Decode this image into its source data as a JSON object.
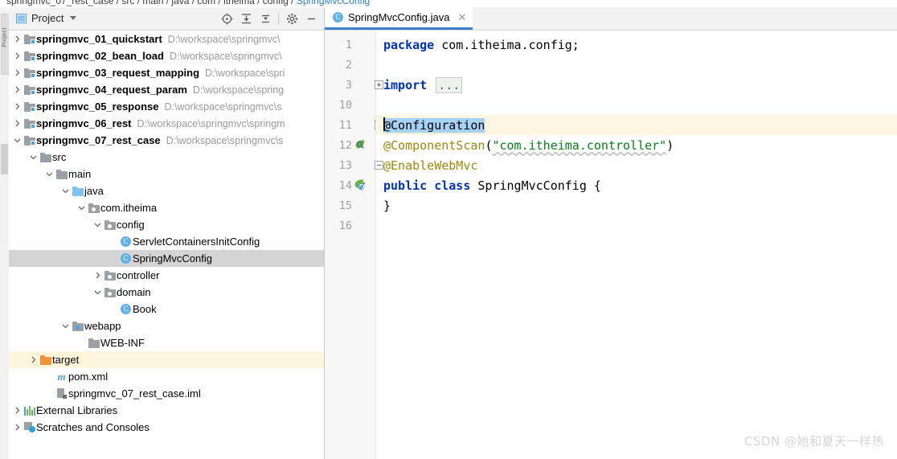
{
  "breadcrumb": {
    "text": "springmvc_07_rest_case  /  src  /  main  /  java  /  com  /  itheima  /  config  /",
    "leaf": "SpringMvcConfig"
  },
  "tool_strip": {
    "label": "Project"
  },
  "project_panel": {
    "title": "Project",
    "title_icon": "project-icon",
    "caret_icon": "chevron-down-icon",
    "tools": [
      {
        "name": "locate-icon",
        "tooltip": "Select Opened File"
      },
      {
        "name": "expand-all-icon",
        "tooltip": "Expand All"
      },
      {
        "name": "collapse-all-icon",
        "tooltip": "Collapse All"
      },
      {
        "name": "gear-icon",
        "tooltip": "Settings"
      },
      {
        "name": "minimize-icon",
        "tooltip": "Hide"
      }
    ]
  },
  "tree": {
    "items": [
      {
        "label": "springmvc_01_quickstart",
        "path": "D:\\workspace\\springmvc\\",
        "icon": "module-folder-icon",
        "arrow": "collapsed",
        "depth": 0,
        "bold": true,
        "state": "normal"
      },
      {
        "label": "springmvc_02_bean_load",
        "path": "D:\\workspace\\springmvc\\",
        "icon": "module-folder-icon",
        "arrow": "collapsed",
        "depth": 0,
        "bold": true,
        "state": "normal"
      },
      {
        "label": "springmvc_03_request_mapping",
        "path": "D:\\workspace\\spri",
        "icon": "module-folder-icon",
        "arrow": "collapsed",
        "depth": 0,
        "bold": true,
        "state": "normal"
      },
      {
        "label": "springmvc_04_request_param",
        "path": "D:\\workspace\\spring",
        "icon": "module-folder-icon",
        "arrow": "collapsed",
        "depth": 0,
        "bold": true,
        "state": "normal"
      },
      {
        "label": "springmvc_05_response",
        "path": "D:\\workspace\\springmvc\\s",
        "icon": "module-folder-icon",
        "arrow": "collapsed",
        "depth": 0,
        "bold": true,
        "state": "normal"
      },
      {
        "label": "springmvc_06_rest",
        "path": "D:\\workspace\\springmvc\\springm",
        "icon": "module-folder-icon",
        "arrow": "collapsed",
        "depth": 0,
        "bold": true,
        "state": "normal"
      },
      {
        "label": "springmvc_07_rest_case",
        "path": "D:\\workspace\\springmvc\\s",
        "icon": "module-folder-icon",
        "arrow": "expanded",
        "depth": 0,
        "bold": true,
        "state": "normal"
      },
      {
        "label": "src",
        "path": "",
        "icon": "folder-icon",
        "arrow": "expanded",
        "depth": 1,
        "bold": false,
        "state": "normal"
      },
      {
        "label": "main",
        "path": "",
        "icon": "folder-icon",
        "arrow": "expanded",
        "depth": 2,
        "bold": false,
        "state": "normal"
      },
      {
        "label": "java",
        "path": "",
        "icon": "source-folder-icon",
        "arrow": "expanded",
        "depth": 3,
        "bold": false,
        "state": "normal"
      },
      {
        "label": "com.itheima",
        "path": "",
        "icon": "package-icon",
        "arrow": "expanded",
        "depth": 4,
        "bold": false,
        "state": "normal"
      },
      {
        "label": "config",
        "path": "",
        "icon": "package-icon",
        "arrow": "expanded",
        "depth": 5,
        "bold": false,
        "state": "normal"
      },
      {
        "label": "ServletContainersInitConfig",
        "path": "",
        "icon": "java-class-icon",
        "arrow": "none",
        "depth": 6,
        "bold": false,
        "state": "normal"
      },
      {
        "label": "SpringMvcConfig",
        "path": "",
        "icon": "java-class-icon",
        "arrow": "none",
        "depth": 6,
        "bold": false,
        "state": "selected"
      },
      {
        "label": "controller",
        "path": "",
        "icon": "package-icon",
        "arrow": "collapsed",
        "depth": 5,
        "bold": false,
        "state": "normal"
      },
      {
        "label": "domain",
        "path": "",
        "icon": "package-icon",
        "arrow": "expanded",
        "depth": 5,
        "bold": false,
        "state": "normal"
      },
      {
        "label": "Book",
        "path": "",
        "icon": "java-class-icon",
        "arrow": "none",
        "depth": 6,
        "bold": false,
        "state": "normal"
      },
      {
        "label": "webapp",
        "path": "",
        "icon": "webapp-folder-icon",
        "arrow": "expanded",
        "depth": 3,
        "bold": false,
        "state": "normal"
      },
      {
        "label": "WEB-INF",
        "path": "",
        "icon": "folder-icon",
        "arrow": "none",
        "depth": 4,
        "bold": false,
        "state": "normal"
      },
      {
        "label": "target",
        "path": "",
        "icon": "target-folder-icon",
        "arrow": "collapsed",
        "depth": 1,
        "bold": false,
        "state": "highlighted"
      },
      {
        "label": "pom.xml",
        "path": "",
        "icon": "maven-pom-icon",
        "arrow": "none",
        "depth": 2,
        "bold": false,
        "state": "normal"
      },
      {
        "label": "springmvc_07_rest_case.iml",
        "path": "",
        "icon": "iml-file-icon",
        "arrow": "none",
        "depth": 2,
        "bold": false,
        "state": "normal"
      },
      {
        "label": "External Libraries",
        "path": "",
        "icon": "libraries-icon",
        "arrow": "collapsed",
        "depth": 0,
        "bold": false,
        "state": "normal"
      },
      {
        "label": "Scratches and Consoles",
        "path": "",
        "icon": "scratches-icon",
        "arrow": "collapsed",
        "depth": 0,
        "bold": false,
        "state": "normal"
      }
    ]
  },
  "editor": {
    "tab": {
      "label": "SpringMvcConfig.java",
      "icon": "java-class-icon",
      "close_icon": "close-icon",
      "active": true
    },
    "lines": [
      {
        "number": "1",
        "fold": "none",
        "gutter_icon": "",
        "current": false,
        "tokens": [
          {
            "t": "package ",
            "c": "kw"
          },
          {
            "t": "com.itheima.config;",
            "c": "plain"
          }
        ]
      },
      {
        "number": "2",
        "fold": "none",
        "gutter_icon": "",
        "current": false,
        "tokens": []
      },
      {
        "number": "3",
        "fold": "plus",
        "gutter_icon": "",
        "current": false,
        "tokens": [
          {
            "t": "import ",
            "c": "kw"
          },
          {
            "t": "...",
            "c": "fold-ph"
          }
        ]
      },
      {
        "number": "10",
        "fold": "none",
        "gutter_icon": "",
        "current": false,
        "tokens": []
      },
      {
        "number": "11",
        "fold": "minus",
        "gutter_icon": "",
        "current": true,
        "tokens": [
          {
            "t": "@Configuration",
            "c": "sel-text"
          }
        ]
      },
      {
        "number": "12",
        "fold": "none",
        "gutter_icon": "bean-scan-icon",
        "current": false,
        "tokens": [
          {
            "t": "@ComponentScan",
            "c": "ann"
          },
          {
            "t": "(",
            "c": "punc"
          },
          {
            "t": "\"com.itheima.controller\"",
            "c": "str squiggle"
          },
          {
            "t": ")",
            "c": "punc"
          }
        ]
      },
      {
        "number": "13",
        "fold": "minus",
        "gutter_icon": "",
        "current": false,
        "tokens": [
          {
            "t": "@EnableWebMvc",
            "c": "ann"
          }
        ]
      },
      {
        "number": "14",
        "fold": "none",
        "gutter_icon": "spring-bean-icon",
        "current": false,
        "tokens": [
          {
            "t": "public class ",
            "c": "kw"
          },
          {
            "t": "SpringMvcConfig ",
            "c": "cls"
          },
          {
            "t": "{",
            "c": "punc"
          }
        ]
      },
      {
        "number": "15",
        "fold": "none",
        "gutter_icon": "",
        "current": false,
        "tokens": [
          {
            "t": "}",
            "c": "punc"
          }
        ]
      },
      {
        "number": "16",
        "fold": "none",
        "gutter_icon": "",
        "current": false,
        "tokens": []
      }
    ]
  },
  "watermark": {
    "text": "CSDN @她和夏天一样热"
  },
  "colors": {
    "accent": "#3c7fd1",
    "selection": "#a6d2f5",
    "current_line": "#fdf6e3",
    "tree_selection": "#d4d4d4",
    "tree_highlight": "#fdf6dd",
    "keyword": "#0033b3",
    "annotation": "#9e880d",
    "string": "#067d17",
    "path_text": "#9a9a9a"
  }
}
